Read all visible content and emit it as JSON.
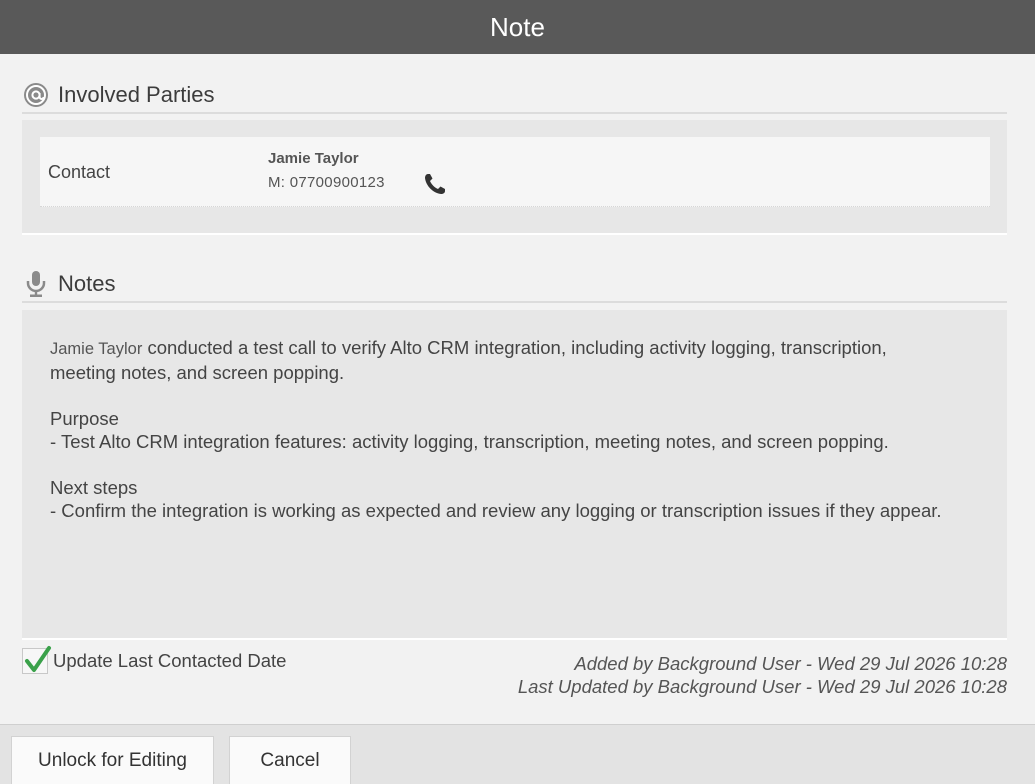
{
  "window": {
    "title": "Note"
  },
  "involved": {
    "heading": "Involved Parties",
    "icon": "at-sign-icon",
    "contact": {
      "role": "Contact",
      "name": "Jamie Taylor",
      "phone": "M: 07700900123",
      "phone_icon": "phone-icon"
    }
  },
  "notes": {
    "heading": "Notes",
    "icon": "microphone-icon",
    "speaker": "Jamie Taylor",
    "summary_line1": "conducted a test call to verify Alto CRM integration, including activity logging, transcription,",
    "summary_line2": "meeting notes, and screen popping.",
    "purpose_heading": "Purpose",
    "purpose_item": "- Test Alto CRM integration features: activity logging, transcription, meeting notes, and screen popping.",
    "next_heading": "Next steps",
    "next_item": "- Confirm the integration is working as expected and review any logging or transcription issues if they appear."
  },
  "footer": {
    "update_label": "Update Last Contacted Date",
    "update_checked": true,
    "added_by": "Added by Background User - Wed 29 Jul 2026 10:28",
    "updated_by": "Last Updated by Background User - Wed 29 Jul 2026 10:28"
  },
  "buttons": {
    "unlock": "Unlock for Editing",
    "cancel": "Cancel"
  },
  "colors": {
    "titlebar": "#595959",
    "panel": "#e7e7e7",
    "checkmark": "#3aa14a"
  }
}
